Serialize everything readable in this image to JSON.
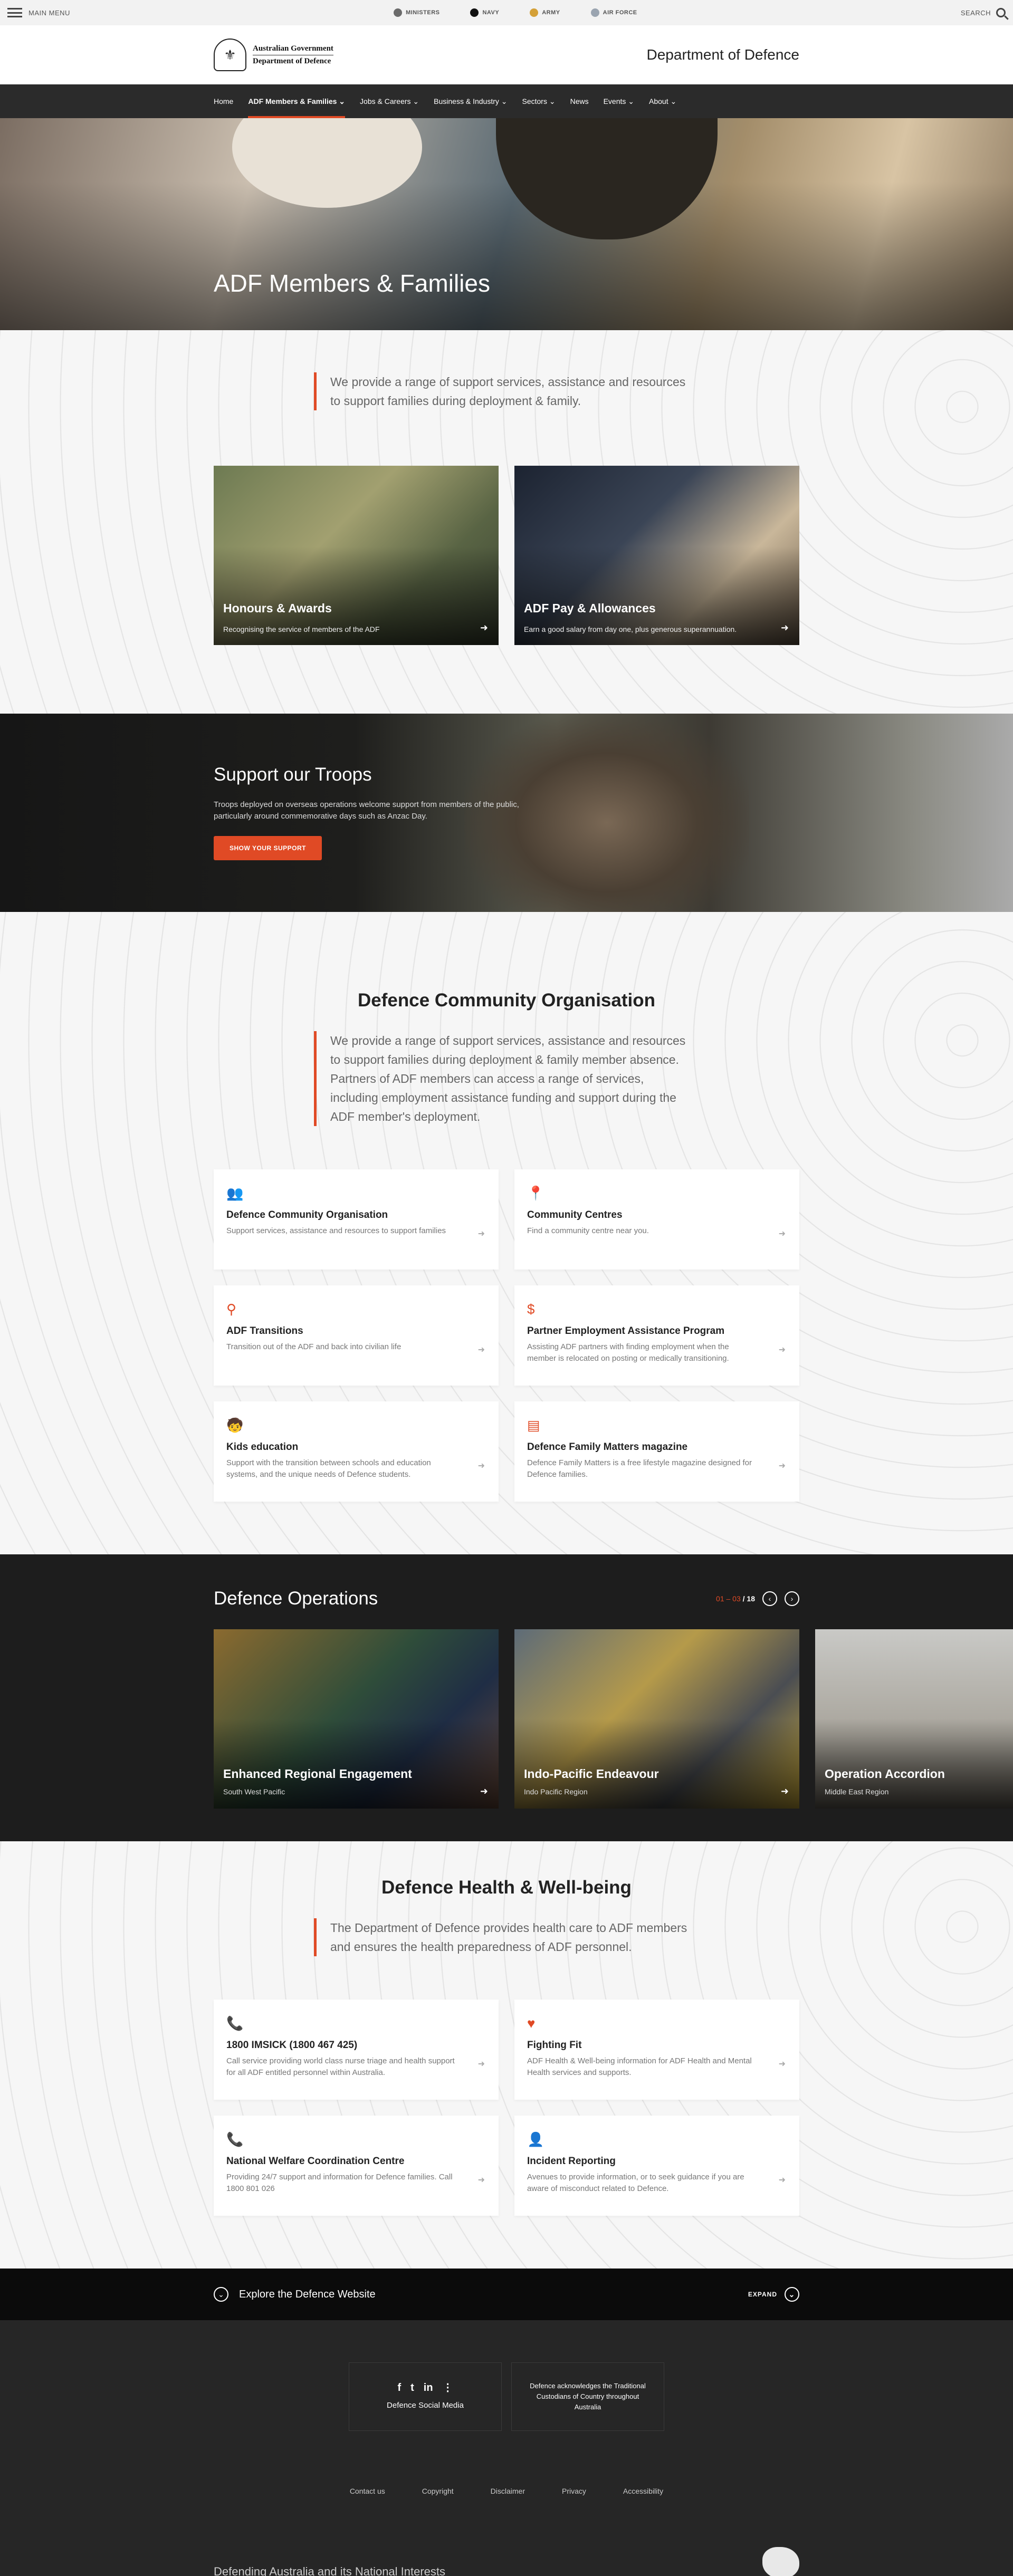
{
  "topbar": {
    "menu_label": "MAIN MENU",
    "services": [
      {
        "label": "MINISTERS",
        "icon": "ministers-icon",
        "color": "#6b6b6b"
      },
      {
        "label": "NAVY",
        "icon": "navy-icon",
        "color": "#111111"
      },
      {
        "label": "ARMY",
        "icon": "army-icon",
        "color": "#d4a037"
      },
      {
        "label": "AIR FORCE",
        "icon": "air-force-icon",
        "color": "#9aa4b0"
      }
    ],
    "search_label": "SEARCH"
  },
  "brand": {
    "logo_line1": "Australian Government",
    "logo_line2": "Department of Defence",
    "department": "Department of Defence"
  },
  "nav": {
    "items": [
      {
        "label": "Home"
      },
      {
        "label": "ADF Members & Families ⌄",
        "active": true
      },
      {
        "label": "Jobs & Careers ⌄"
      },
      {
        "label": "Business & Industry ⌄"
      },
      {
        "label": "Sectors ⌄"
      },
      {
        "label": "News"
      },
      {
        "label": "Events ⌄"
      },
      {
        "label": "About ⌄"
      }
    ]
  },
  "hero": {
    "title": "ADF Members & Families"
  },
  "intro": {
    "text": "We provide a range of support services, assistance and resources to support families during deployment & family."
  },
  "promo_cards": [
    {
      "title": "Honours & Awards",
      "subtitle": "Recognising the service of members of the ADF"
    },
    {
      "title": "ADF Pay & Allowances",
      "subtitle": "Earn a good salary from day one, plus generous superannuation."
    }
  ],
  "troops": {
    "title": "Support our Troops",
    "text": "Troops deployed on overseas operations welcome support from members of the public, particularly around commemorative days such as Anzac Day.",
    "button": "SHOW YOUR SUPPORT"
  },
  "dco": {
    "title": "Defence Community Organisation",
    "text": "We provide a range of support services, assistance and resources to support families during deployment & family member absence. Partners of ADF members can access a range of services, including employment assistance funding and support during the ADF member's deployment.",
    "cards": [
      {
        "icon": "group-icon",
        "glyph": "👥",
        "title": "Defence Community Organisation",
        "desc": "Support services, assistance and resources to support families"
      },
      {
        "icon": "location-pin-icon",
        "glyph": "📍",
        "title": "Community Centres",
        "desc": "Find a community centre near you."
      },
      {
        "icon": "transition-icon",
        "glyph": "⚲",
        "title": "ADF Transitions",
        "desc": "Transition out of the ADF and back into civilian life"
      },
      {
        "icon": "dollar-icon",
        "glyph": "$",
        "title": "Partner Employment Assistance Program",
        "desc": "Assisting ADF partners with finding employment when the member is relocated on posting or medically transitioning."
      },
      {
        "icon": "child-icon",
        "glyph": "🧒",
        "title": "Kids education",
        "desc": "Support with the transition between schools and education systems, and the unique needs of Defence students."
      },
      {
        "icon": "magazine-icon",
        "glyph": "▤",
        "title": "Defence Family Matters magazine",
        "desc": "Defence Family Matters is a free lifestyle magazine designed for Defence families."
      }
    ]
  },
  "operations": {
    "title": "Defence Operations",
    "range": "01 – 03",
    "total": "/ 18",
    "slides": [
      {
        "title": "Enhanced Regional Engagement",
        "subtitle": "South West Pacific",
        "bg": "linear-gradient(135deg,#8b6a2f,#2f4d3a 45%,#1f2d45 70%,#6a4a3a)"
      },
      {
        "title": "Indo-Pacific Endeavour",
        "subtitle": "Indo Pacific Region",
        "bg": "linear-gradient(135deg,#5d6b78,#b59a4a 40%,#4a4d52 70%,#d4b23c)"
      },
      {
        "title": "Operation Accordion",
        "subtitle": "Middle East Region",
        "bg": "linear-gradient(180deg,#c9c9c6,#a7a39a 60%,#6b665c)"
      }
    ]
  },
  "health": {
    "title": "Defence Health & Well-being",
    "text": "The Department of Defence provides health care to ADF members and ensures the health preparedness of ADF personnel.",
    "cards": [
      {
        "icon": "phone-icon",
        "glyph": "📞",
        "title": "1800 IMSICK (1800 467 425)",
        "desc": "Call service providing world class nurse triage and health support for all ADF entitled personnel within Australia."
      },
      {
        "icon": "heart-icon",
        "glyph": "♥",
        "title": "Fighting Fit",
        "desc": "ADF Health & Well-being information for ADF Health and Mental Health services and supports."
      },
      {
        "icon": "phone-icon",
        "glyph": "📞",
        "title": "National Welfare Coordination Centre",
        "desc": "Providing 24/7 support and information for Defence families. Call 1800 801 026"
      },
      {
        "icon": "report-icon",
        "glyph": "👤",
        "title": "Incident Reporting",
        "desc": "Avenues to provide information, or to seek guidance if you are aware of misconduct related to Defence."
      }
    ]
  },
  "explore": {
    "label": "Explore the Defence Website",
    "expand": "EXPAND"
  },
  "footer": {
    "social_label": "Defence Social Media",
    "social_icons": [
      "f",
      "t",
      "in",
      "⋮"
    ],
    "acknowledgement": "Defence acknowledges the Traditional Custodians of Country throughout Australia",
    "links": [
      "Contact us",
      "Copyright",
      "Disclaimer",
      "Privacy",
      "Accessibility"
    ],
    "motto": "Defending Australia and its National Interests"
  },
  "colors": {
    "accent": "#e04a25",
    "dark": "#2b2b2b",
    "ops_bg": "#1d1d1d"
  }
}
